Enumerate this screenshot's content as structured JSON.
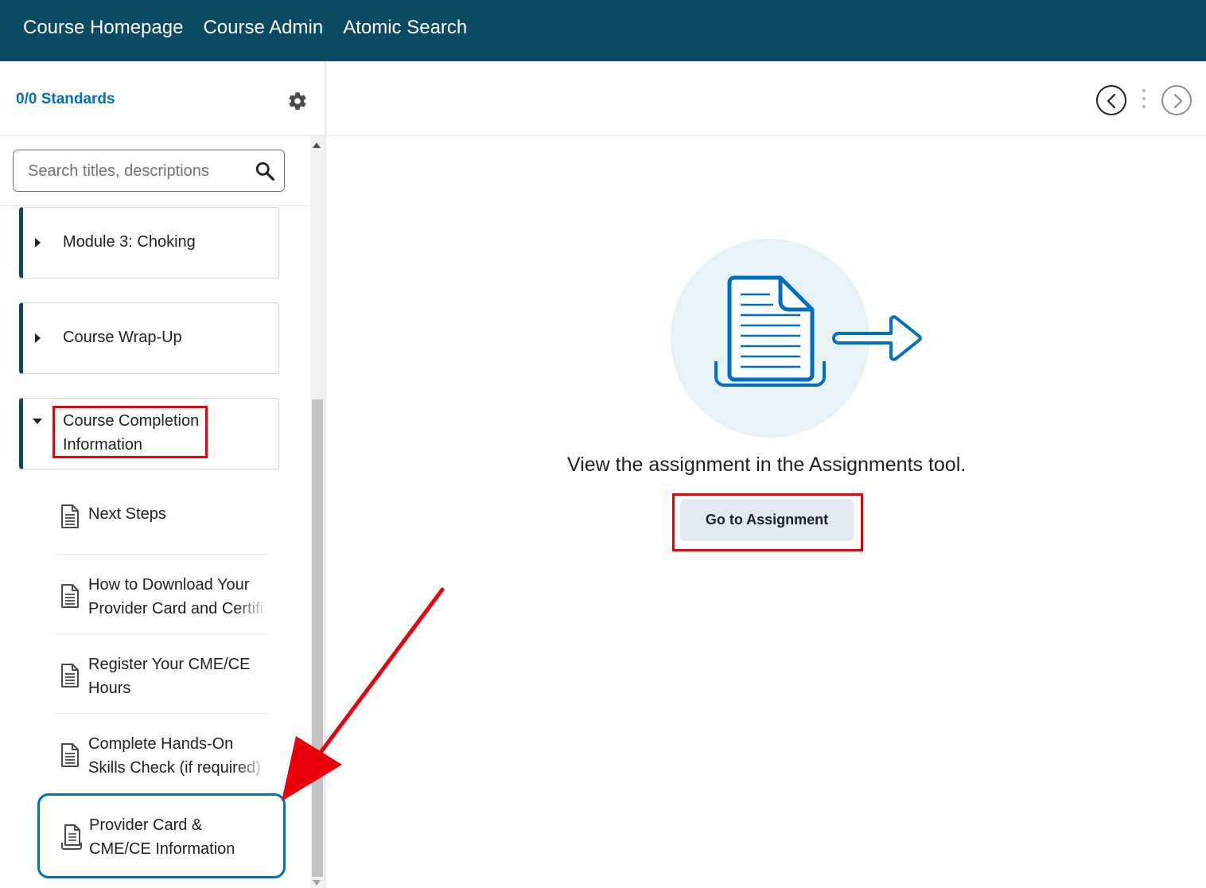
{
  "topnav": {
    "items": [
      "Course Homepage",
      "Course Admin",
      "Atomic Search"
    ]
  },
  "sidebar": {
    "standards_label": "0/0 Standards",
    "search_placeholder": "Search titles, descriptions",
    "modules": [
      {
        "label": "Module 3: Choking",
        "expanded": false
      },
      {
        "label": "Course Wrap-Up",
        "expanded": false
      },
      {
        "label": "Course Completion Information",
        "expanded": true
      }
    ],
    "topics": [
      {
        "title_line1": "Next Steps",
        "title_line2": ""
      },
      {
        "title_line1": "How to Download Your",
        "title_line2": "Provider Card and Certificate"
      },
      {
        "title_line1": "Register Your CME/CE",
        "title_line2": "Hours"
      },
      {
        "title_line1": "Complete Hands-On",
        "title_line2": "Skills Check (if required)"
      },
      {
        "title_line1": "Provider Card &",
        "title_line2": "CME/CE Information",
        "selected": true
      }
    ]
  },
  "main": {
    "message": "View the assignment in the Assignments tool.",
    "button_label": "Go to Assignment"
  },
  "colors": {
    "topbar": "#0b4a63",
    "link": "#006fbf",
    "annotation_red": "#e8000b",
    "selected_border": "#006fbf"
  },
  "icons": {
    "settings": "gear-icon",
    "search": "search-icon",
    "topic": "document-icon",
    "previous": "chevron-left-icon",
    "next": "chevron-right-icon"
  }
}
